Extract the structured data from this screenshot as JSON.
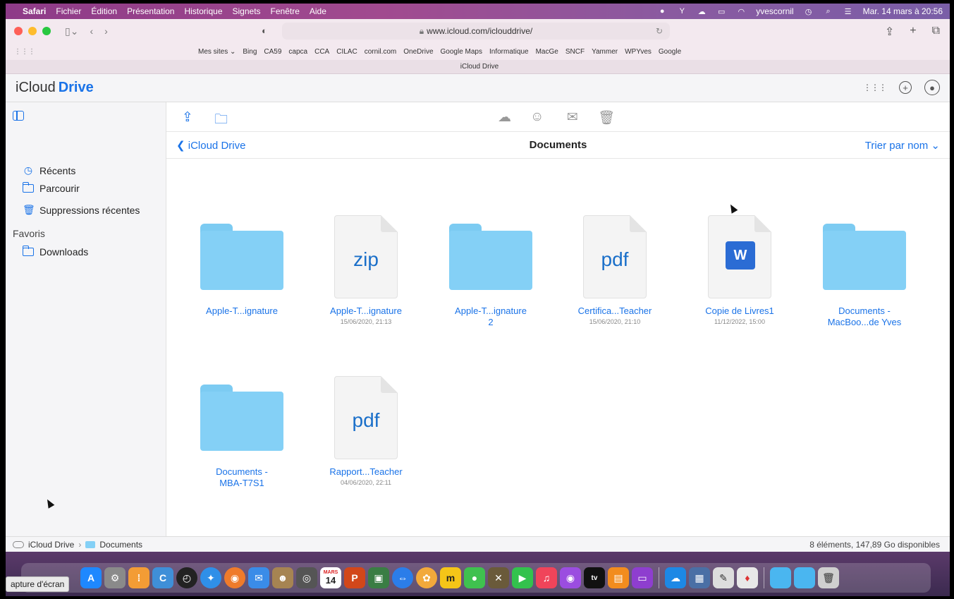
{
  "menubar": {
    "app": "Safari",
    "menus": [
      "Fichier",
      "Édition",
      "Présentation",
      "Historique",
      "Signets",
      "Fenêtre",
      "Aide"
    ],
    "user": "yvescornil",
    "datetime": "Mar. 14 mars à 20:56"
  },
  "browser": {
    "url": "www.icloud.com/iclouddrive/",
    "tab_title": "iCloud Drive",
    "favorites": [
      "Mes sites ⌄",
      "Bing",
      "CA59",
      "capca",
      "CCA",
      "CILAC",
      "cornil.com",
      "OneDrive",
      "Google Maps",
      "Informatique",
      "MacGe",
      "SNCF",
      "Yammer",
      "WPYves",
      "Google"
    ]
  },
  "header": {
    "brand_prefix": "iCloud",
    "brand_name": "Drive"
  },
  "sidebar": {
    "items": [
      {
        "label": "Récents"
      },
      {
        "label": "Parcourir"
      },
      {
        "label": "Suppressions récentes"
      }
    ],
    "favorites_title": "Favoris",
    "favorites": [
      {
        "label": "Downloads"
      }
    ]
  },
  "main": {
    "back_label": "iCloud Drive",
    "title": "Documents",
    "sort_label": "Trier par nom ⌄",
    "items": [
      {
        "type": "folder",
        "name": "Apple-T...ignature",
        "date": ""
      },
      {
        "type": "file",
        "ext": "zip",
        "name": "Apple-T...ignature",
        "date": "15/06/2020, 21:13"
      },
      {
        "type": "folder",
        "name": "Apple-T...ignature 2",
        "date": ""
      },
      {
        "type": "file",
        "ext": "pdf",
        "name": "Certifica...Teacher",
        "date": "15/06/2020, 21:10"
      },
      {
        "type": "word",
        "name": "Copie de Livres1",
        "date": "11/12/2022, 15:00"
      },
      {
        "type": "folder",
        "name": "Documents - MacBoo...de Yves",
        "date": ""
      },
      {
        "type": "folder",
        "name": "Documents - MBA-T7S1",
        "date": ""
      },
      {
        "type": "file",
        "ext": "pdf",
        "name": "Rapport...Teacher",
        "date": "04/06/2020, 22:11"
      }
    ]
  },
  "statusbar": {
    "root": "iCloud Drive",
    "current": "Documents",
    "info": "8 éléments, 147,89 Go disponibles"
  },
  "dock": {
    "tooltip": "apture d'écran",
    "calendar_month": "MARS",
    "calendar_day": "14"
  }
}
